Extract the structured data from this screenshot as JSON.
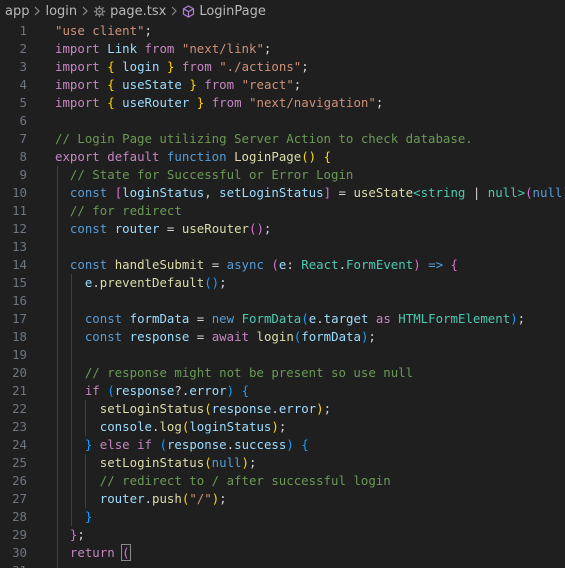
{
  "breadcrumb": {
    "folder1": "app",
    "folder2": "login",
    "file": "page.tsx",
    "symbol": "LoginPage"
  },
  "colors": {
    "background": "#1f1f1f",
    "string": "#ce9178",
    "import_keyword": "#c586c0",
    "keyword": "#569cd6",
    "variable": "#9cdcfe",
    "function": "#dcdcaa",
    "type": "#4ec9b0",
    "comment": "#6a9955",
    "bracket_level1": "#ffd700",
    "bracket_level2": "#da70d6",
    "bracket_level3": "#179fff",
    "line_number": "#6e7681"
  },
  "icons": [
    "chevron-right-icon",
    "gear-icon",
    "symbol-method-icon"
  ],
  "lines": [
    {
      "n": "1",
      "tokens": [
        [
          "\"use client\"",
          "str"
        ],
        [
          ";",
          "op"
        ]
      ]
    },
    {
      "n": "2",
      "tokens": [
        [
          "import",
          "imp"
        ],
        [
          " ",
          "op"
        ],
        [
          "Link",
          "var"
        ],
        [
          " ",
          "op"
        ],
        [
          "from",
          "imp"
        ],
        [
          " ",
          "op"
        ],
        [
          "\"next/link\"",
          "str"
        ],
        [
          ";",
          "op"
        ]
      ]
    },
    {
      "n": "3",
      "tokens": [
        [
          "import",
          "imp"
        ],
        [
          " ",
          "op"
        ],
        [
          "{",
          "b1"
        ],
        [
          " ",
          "op"
        ],
        [
          "login",
          "var"
        ],
        [
          " ",
          "op"
        ],
        [
          "}",
          "b1"
        ],
        [
          " ",
          "op"
        ],
        [
          "from",
          "imp"
        ],
        [
          " ",
          "op"
        ],
        [
          "\"./actions\"",
          "str"
        ],
        [
          ";",
          "op"
        ]
      ]
    },
    {
      "n": "4",
      "tokens": [
        [
          "import",
          "imp"
        ],
        [
          " ",
          "op"
        ],
        [
          "{",
          "b1"
        ],
        [
          " ",
          "op"
        ],
        [
          "useState",
          "var"
        ],
        [
          " ",
          "op"
        ],
        [
          "}",
          "b1"
        ],
        [
          " ",
          "op"
        ],
        [
          "from",
          "imp"
        ],
        [
          " ",
          "op"
        ],
        [
          "\"react\"",
          "str"
        ],
        [
          ";",
          "op"
        ]
      ]
    },
    {
      "n": "5",
      "tokens": [
        [
          "import",
          "imp"
        ],
        [
          " ",
          "op"
        ],
        [
          "{",
          "b1"
        ],
        [
          " ",
          "op"
        ],
        [
          "useRouter",
          "var"
        ],
        [
          " ",
          "op"
        ],
        [
          "}",
          "b1"
        ],
        [
          " ",
          "op"
        ],
        [
          "from",
          "imp"
        ],
        [
          " ",
          "op"
        ],
        [
          "\"next/navigation\"",
          "str"
        ],
        [
          ";",
          "op"
        ]
      ]
    },
    {
      "n": "6",
      "tokens": []
    },
    {
      "n": "7",
      "tokens": [
        [
          "// Login Page utilizing Server Action to check database.",
          "cm"
        ]
      ]
    },
    {
      "n": "8",
      "tokens": [
        [
          "export",
          "imp"
        ],
        [
          " ",
          "op"
        ],
        [
          "default",
          "imp"
        ],
        [
          " ",
          "op"
        ],
        [
          "function",
          "kw"
        ],
        [
          " ",
          "op"
        ],
        [
          "LoginPage",
          "fn"
        ],
        [
          "()",
          "b1"
        ],
        [
          " ",
          "op"
        ],
        [
          "{",
          "b1"
        ]
      ]
    },
    {
      "n": "9",
      "tokens": [
        [
          "  ",
          "op"
        ],
        [
          "// State for Successful or Error Login",
          "cm"
        ]
      ]
    },
    {
      "n": "10",
      "tokens": [
        [
          "  ",
          "op"
        ],
        [
          "const",
          "kw"
        ],
        [
          " ",
          "op"
        ],
        [
          "[",
          "b2"
        ],
        [
          "loginStatus",
          "var"
        ],
        [
          ", ",
          "op"
        ],
        [
          "setLoginStatus",
          "var"
        ],
        [
          "]",
          "b2"
        ],
        [
          " = ",
          "op"
        ],
        [
          "useState",
          "fn"
        ],
        [
          "<",
          "ty"
        ],
        [
          "string",
          "ty"
        ],
        [
          " | ",
          "op"
        ],
        [
          "null",
          "ty"
        ],
        [
          ">",
          "ty"
        ],
        [
          "(",
          "b2"
        ],
        [
          "null",
          "kw"
        ],
        [
          ")",
          "b2"
        ],
        [
          ";",
          "op"
        ]
      ]
    },
    {
      "n": "11",
      "tokens": [
        [
          "  ",
          "op"
        ],
        [
          "// for redirect",
          "cm"
        ]
      ]
    },
    {
      "n": "12",
      "tokens": [
        [
          "  ",
          "op"
        ],
        [
          "const",
          "kw"
        ],
        [
          " ",
          "op"
        ],
        [
          "router",
          "var"
        ],
        [
          " = ",
          "op"
        ],
        [
          "useRouter",
          "fn"
        ],
        [
          "()",
          "b2"
        ],
        [
          ";",
          "op"
        ]
      ]
    },
    {
      "n": "13",
      "tokens": []
    },
    {
      "n": "14",
      "tokens": [
        [
          "  ",
          "op"
        ],
        [
          "const",
          "kw"
        ],
        [
          " ",
          "op"
        ],
        [
          "handleSubmit",
          "fn"
        ],
        [
          " = ",
          "op"
        ],
        [
          "async",
          "kw"
        ],
        [
          " ",
          "op"
        ],
        [
          "(",
          "b2"
        ],
        [
          "e",
          "var"
        ],
        [
          ": ",
          "op"
        ],
        [
          "React",
          "ty"
        ],
        [
          ".",
          "op"
        ],
        [
          "FormEvent",
          "ty"
        ],
        [
          ")",
          "b2"
        ],
        [
          " ",
          "op"
        ],
        [
          "=>",
          "kw"
        ],
        [
          " ",
          "op"
        ],
        [
          "{",
          "b2"
        ]
      ]
    },
    {
      "n": "15",
      "tokens": [
        [
          "    ",
          "op"
        ],
        [
          "e",
          "var"
        ],
        [
          ".",
          "op"
        ],
        [
          "preventDefault",
          "fn"
        ],
        [
          "()",
          "b3"
        ],
        [
          ";",
          "op"
        ]
      ]
    },
    {
      "n": "16",
      "tokens": []
    },
    {
      "n": "17",
      "tokens": [
        [
          "    ",
          "op"
        ],
        [
          "const",
          "kw"
        ],
        [
          " ",
          "op"
        ],
        [
          "formData",
          "var"
        ],
        [
          " = ",
          "op"
        ],
        [
          "new",
          "kw"
        ],
        [
          " ",
          "op"
        ],
        [
          "FormData",
          "ty"
        ],
        [
          "(",
          "b3"
        ],
        [
          "e",
          "var"
        ],
        [
          ".",
          "op"
        ],
        [
          "target",
          "var"
        ],
        [
          " ",
          "op"
        ],
        [
          "as",
          "imp"
        ],
        [
          " ",
          "op"
        ],
        [
          "HTMLFormElement",
          "ty"
        ],
        [
          ")",
          "b3"
        ],
        [
          ";",
          "op"
        ]
      ]
    },
    {
      "n": "18",
      "tokens": [
        [
          "    ",
          "op"
        ],
        [
          "const",
          "kw"
        ],
        [
          " ",
          "op"
        ],
        [
          "response",
          "var"
        ],
        [
          " = ",
          "op"
        ],
        [
          "await",
          "imp"
        ],
        [
          " ",
          "op"
        ],
        [
          "login",
          "fn"
        ],
        [
          "(",
          "b3"
        ],
        [
          "formData",
          "var"
        ],
        [
          ")",
          "b3"
        ],
        [
          ";",
          "op"
        ]
      ]
    },
    {
      "n": "19",
      "tokens": []
    },
    {
      "n": "20",
      "tokens": [
        [
          "    ",
          "op"
        ],
        [
          "// response might not be present so use null",
          "cm"
        ]
      ]
    },
    {
      "n": "21",
      "tokens": [
        [
          "    ",
          "op"
        ],
        [
          "if",
          "imp"
        ],
        [
          " ",
          "op"
        ],
        [
          "(",
          "b3"
        ],
        [
          "response",
          "var"
        ],
        [
          "?.",
          "op"
        ],
        [
          "error",
          "var"
        ],
        [
          ")",
          "b3"
        ],
        [
          " ",
          "op"
        ],
        [
          "{",
          "b3"
        ]
      ]
    },
    {
      "n": "22",
      "tokens": [
        [
          "      ",
          "op"
        ],
        [
          "setLoginStatus",
          "fn"
        ],
        [
          "(",
          "b1"
        ],
        [
          "response",
          "var"
        ],
        [
          ".",
          "op"
        ],
        [
          "error",
          "var"
        ],
        [
          ")",
          "b1"
        ],
        [
          ";",
          "op"
        ]
      ]
    },
    {
      "n": "23",
      "tokens": [
        [
          "      ",
          "op"
        ],
        [
          "console",
          "var"
        ],
        [
          ".",
          "op"
        ],
        [
          "log",
          "fn"
        ],
        [
          "(",
          "b1"
        ],
        [
          "loginStatus",
          "var"
        ],
        [
          ")",
          "b1"
        ],
        [
          ";",
          "op"
        ]
      ]
    },
    {
      "n": "24",
      "tokens": [
        [
          "    ",
          "op"
        ],
        [
          "}",
          "b3"
        ],
        [
          " ",
          "op"
        ],
        [
          "else",
          "imp"
        ],
        [
          " ",
          "op"
        ],
        [
          "if",
          "imp"
        ],
        [
          " ",
          "op"
        ],
        [
          "(",
          "b3"
        ],
        [
          "response",
          "var"
        ],
        [
          ".",
          "op"
        ],
        [
          "success",
          "var"
        ],
        [
          ")",
          "b3"
        ],
        [
          " ",
          "op"
        ],
        [
          "{",
          "b3"
        ]
      ]
    },
    {
      "n": "25",
      "tokens": [
        [
          "      ",
          "op"
        ],
        [
          "setLoginStatus",
          "fn"
        ],
        [
          "(",
          "b1"
        ],
        [
          "null",
          "kw"
        ],
        [
          ")",
          "b1"
        ],
        [
          ";",
          "op"
        ]
      ]
    },
    {
      "n": "26",
      "tokens": [
        [
          "      ",
          "op"
        ],
        [
          "// redirect to / after successful login",
          "cm"
        ]
      ]
    },
    {
      "n": "27",
      "tokens": [
        [
          "      ",
          "op"
        ],
        [
          "router",
          "var"
        ],
        [
          ".",
          "op"
        ],
        [
          "push",
          "fn"
        ],
        [
          "(",
          "b1"
        ],
        [
          "\"/\"",
          "str"
        ],
        [
          ")",
          "b1"
        ],
        [
          ";",
          "op"
        ]
      ]
    },
    {
      "n": "28",
      "tokens": [
        [
          "    ",
          "op"
        ],
        [
          "}",
          "b3"
        ]
      ]
    },
    {
      "n": "29",
      "tokens": [
        [
          "  ",
          "op"
        ],
        [
          "}",
          "b2"
        ],
        [
          ";",
          "op"
        ]
      ]
    },
    {
      "n": "30",
      "tokens": [
        [
          "  ",
          "op"
        ],
        [
          "return",
          "imp"
        ],
        [
          " ",
          "op"
        ],
        [
          "(",
          "b2"
        ]
      ]
    },
    {
      "n": "31",
      "tokens": []
    }
  ]
}
